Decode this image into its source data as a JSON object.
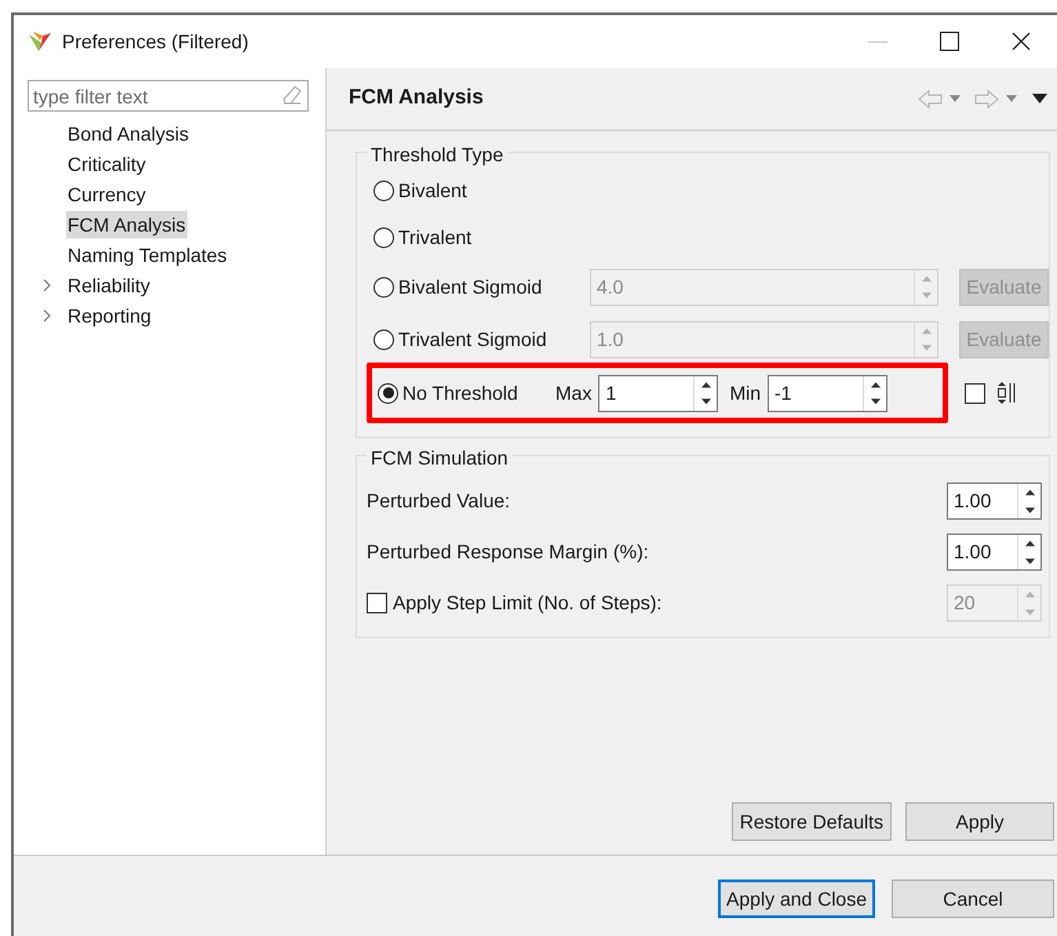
{
  "window": {
    "title": "Preferences (Filtered)"
  },
  "sidebar": {
    "filter": {
      "placeholder": "type filter text"
    },
    "items": [
      {
        "label": "Bond Analysis",
        "selected": false,
        "expandable": false
      },
      {
        "label": "Criticality",
        "selected": false,
        "expandable": false
      },
      {
        "label": "Currency",
        "selected": false,
        "expandable": false
      },
      {
        "label": "FCM Analysis",
        "selected": true,
        "expandable": false
      },
      {
        "label": "Naming Templates",
        "selected": false,
        "expandable": false
      },
      {
        "label": "Reliability",
        "selected": false,
        "expandable": true
      },
      {
        "label": "Reporting",
        "selected": false,
        "expandable": true
      }
    ]
  },
  "page": {
    "title": "FCM Analysis",
    "threshold_type": {
      "title": "Threshold Type",
      "options": [
        {
          "kind": "plain",
          "label": "Bivalent",
          "selected": false
        },
        {
          "kind": "plain",
          "label": "Trivalent",
          "selected": false
        },
        {
          "kind": "sigmoid",
          "label": "Bivalent Sigmoid",
          "selected": false,
          "value": "4.0",
          "disabled": true,
          "button": "Evaluate"
        },
        {
          "kind": "sigmoid",
          "label": "Trivalent Sigmoid",
          "selected": false,
          "value": "1.0",
          "disabled": true,
          "button": "Evaluate"
        },
        {
          "kind": "range",
          "label": "No Threshold",
          "selected": true,
          "highlighted": true,
          "max_label": "Max",
          "max_value": "1",
          "min_label": "Min",
          "min_value": "-1",
          "checked": false
        }
      ]
    },
    "simulation": {
      "title": "FCM Simulation",
      "rows": [
        {
          "kind": "spinner",
          "label": "Perturbed Value:",
          "value": "1.00"
        },
        {
          "kind": "spinner",
          "label": "Perturbed Response Margin (%):",
          "value": "1.00"
        },
        {
          "kind": "checkbox",
          "label": "Apply Step Limit (No. of Steps):",
          "checked": false,
          "value": "20",
          "disabled": true
        }
      ]
    },
    "buttons": [
      "Restore Defaults",
      "Apply"
    ]
  },
  "footer_buttons": [
    {
      "label": "Apply and Close",
      "selected": true
    },
    {
      "label": "Cancel",
      "selected": false
    }
  ]
}
